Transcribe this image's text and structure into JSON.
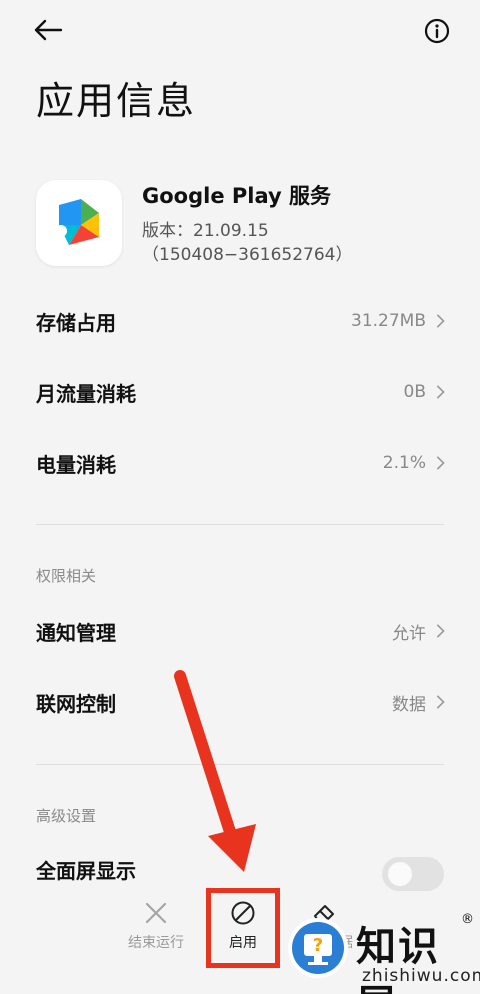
{
  "header": {
    "back_icon": "arrow-left-icon",
    "info_icon": "info-circle-icon",
    "title": "应用信息"
  },
  "app": {
    "name": "Google Play 服务",
    "version": "版本：21.09.15",
    "build": "（150408−361652764）"
  },
  "usage_rows": [
    {
      "label": "存储占用",
      "value": "31.27MB"
    },
    {
      "label": "月流量消耗",
      "value": "0B"
    },
    {
      "label": "电量消耗",
      "value": "2.1%"
    }
  ],
  "permissions": {
    "section_label": "权限相关",
    "rows": [
      {
        "label": "通知管理",
        "value": "允许"
      },
      {
        "label": "联网控制",
        "value": "数据"
      }
    ]
  },
  "advanced": {
    "section_label": "高级设置",
    "fullscreen_label": "全面屏显示"
  },
  "bottom_bar": {
    "stop_label": "结束运行",
    "enable_label": "启用",
    "clear_label": "清除数据",
    "clear_label_visible": "据"
  },
  "watermark": {
    "title": "知识屋",
    "subtitle": "zhishiwu.com",
    "reg": "®"
  },
  "colors": {
    "background": "#f4f4f4",
    "highlight": "#e8331f",
    "watermark_blue": "#2a7fd4"
  }
}
